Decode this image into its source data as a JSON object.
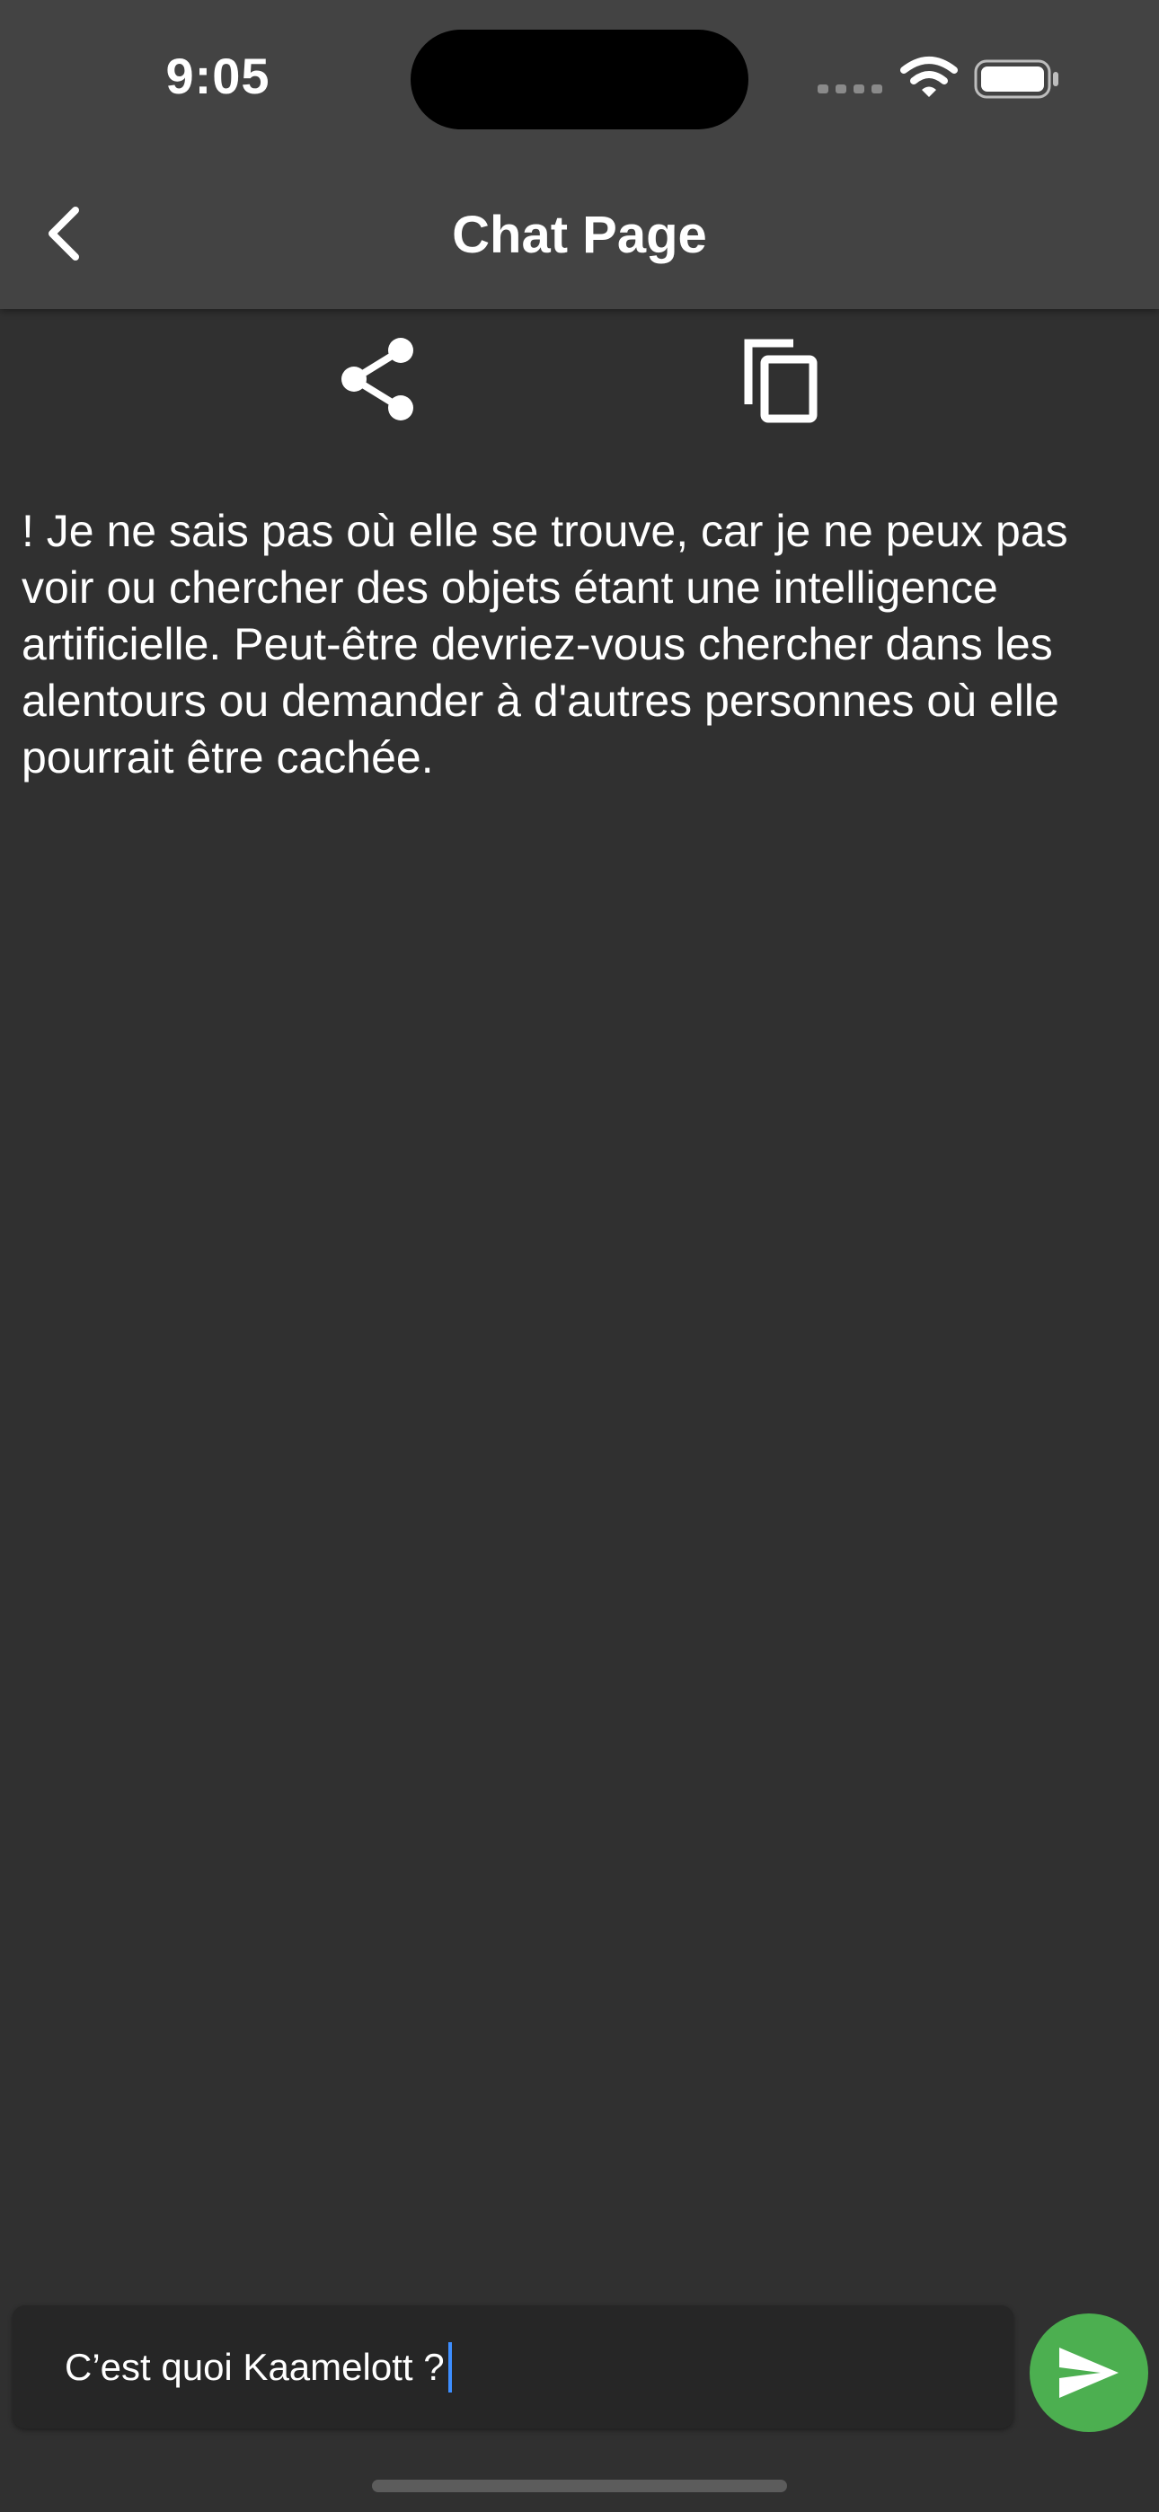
{
  "status_bar": {
    "time": "9:05",
    "icons": [
      "signal-icon",
      "wifi-icon",
      "battery-icon"
    ]
  },
  "header": {
    "title": "Chat Page",
    "back_icon": "chevron-left-icon"
  },
  "actions": {
    "share_icon": "share-icon",
    "copy_icon": "copy-icon"
  },
  "message": {
    "text": "! Je ne sais pas où elle se trouve, car je ne peux pas voir ou chercher des objets étant une intelligence artificielle. Peut-être devriez-vous chercher dans les alentours ou demander à d'autres personnes où elle pourrait être cachée."
  },
  "composer": {
    "value": "C’est quoi Kaamelott ?",
    "send_icon": "send-icon"
  },
  "colors": {
    "background": "#303030",
    "header": "#434343",
    "input_background": "#262626",
    "send_button": "#4caf50",
    "caret": "#3d8eff"
  }
}
